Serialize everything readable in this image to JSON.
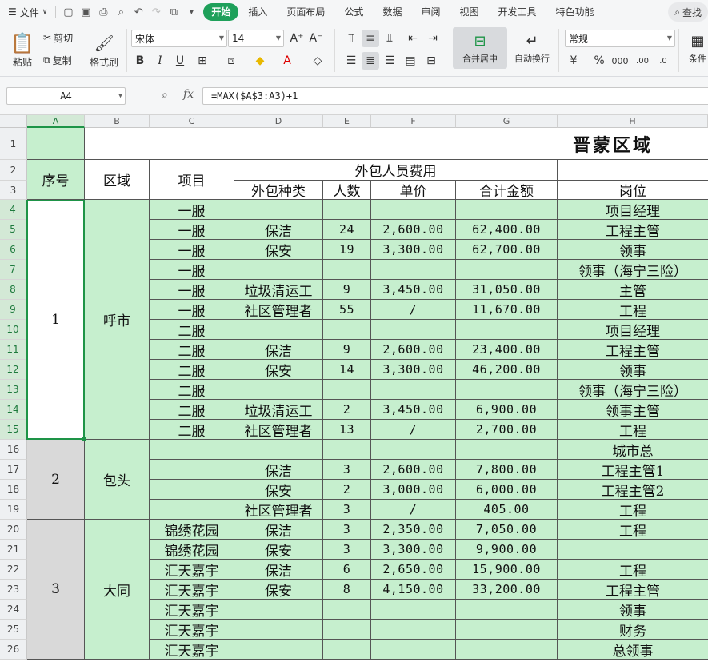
{
  "menu": {
    "file": "文件",
    "tabs": [
      "开始",
      "插入",
      "页面布局",
      "公式",
      "数据",
      "审阅",
      "视图",
      "开发工具",
      "特色功能"
    ],
    "active_tab": "开始",
    "search": "查找",
    "active_color": "#1ea05a"
  },
  "ribbon": {
    "paste": "粘贴",
    "cut": "剪切",
    "copy": "复制",
    "format_painter": "格式刷",
    "font_name": "宋体",
    "font_size": "14",
    "merge_center": "合并居中",
    "wrap_text": "自动换行",
    "number_format": "常规",
    "condition": "条件"
  },
  "formula_bar": {
    "cell_ref": "A4",
    "fx": "fx",
    "formula": "=MAX($A$3:A3)+1"
  },
  "columns": [
    "A",
    "B",
    "C",
    "D",
    "E",
    "F",
    "G",
    "H"
  ],
  "rows": [
    "1",
    "2",
    "3",
    "4",
    "5",
    "6",
    "7",
    "8",
    "9",
    "10",
    "11",
    "12",
    "13",
    "14",
    "15",
    "16",
    "17",
    "18",
    "19",
    "20",
    "21",
    "22",
    "23",
    "24",
    "25",
    "26"
  ],
  "sheet": {
    "title": "晋蒙区域",
    "header": {
      "seq": "序号",
      "region": "区域",
      "project": "项目",
      "outsourcing_cost": "外包人员费用",
      "type": "外包种类",
      "count": "人数",
      "unit_price": "单价",
      "total": "合计金额",
      "post": "岗位"
    },
    "groups": [
      {
        "seq": "1",
        "region": "呼市"
      },
      {
        "seq": "2",
        "region": "包头"
      },
      {
        "seq": "3",
        "region": "大同"
      }
    ],
    "data_rows": [
      {
        "project": "一服",
        "type": "",
        "count": "",
        "price": "",
        "total": "",
        "post": "项目经理"
      },
      {
        "project": "一服",
        "type": "保洁",
        "count": "24",
        "price": "2,600.00",
        "total": "62,400.00",
        "post": "工程主管"
      },
      {
        "project": "一服",
        "type": "保安",
        "count": "19",
        "price": "3,300.00",
        "total": "62,700.00",
        "post": "领事"
      },
      {
        "project": "一服",
        "type": "",
        "count": "",
        "price": "",
        "total": "",
        "post": "领事（海宁三险）"
      },
      {
        "project": "一服",
        "type": "垃圾清运工",
        "count": "9",
        "price": "3,450.00",
        "total": "31,050.00",
        "post": "主管"
      },
      {
        "project": "一服",
        "type": "社区管理者",
        "count": "55",
        "price": "/",
        "total": "11,670.00",
        "post": "工程"
      },
      {
        "project": "二服",
        "type": "",
        "count": "",
        "price": "",
        "total": "",
        "post": "项目经理"
      },
      {
        "project": "二服",
        "type": "保洁",
        "count": "9",
        "price": "2,600.00",
        "total": "23,400.00",
        "post": "工程主管"
      },
      {
        "project": "二服",
        "type": "保安",
        "count": "14",
        "price": "3,300.00",
        "total": "46,200.00",
        "post": "领事"
      },
      {
        "project": "二服",
        "type": "",
        "count": "",
        "price": "",
        "total": "",
        "post": "领事（海宁三险）"
      },
      {
        "project": "二服",
        "type": "垃圾清运工",
        "count": "2",
        "price": "3,450.00",
        "total": "6,900.00",
        "post": "领事主管"
      },
      {
        "project": "二服",
        "type": "社区管理者",
        "count": "13",
        "price": "/",
        "total": "2,700.00",
        "post": "工程"
      },
      {
        "project": "",
        "type": "",
        "count": "",
        "price": "",
        "total": "",
        "post": "城市总"
      },
      {
        "project": "",
        "type": "保洁",
        "count": "3",
        "price": "2,600.00",
        "total": "7,800.00",
        "post": "工程主管1"
      },
      {
        "project": "",
        "type": "保安",
        "count": "2",
        "price": "3,000.00",
        "total": "6,000.00",
        "post": "工程主管2"
      },
      {
        "project": "",
        "type": "社区管理者",
        "count": "3",
        "price": "/",
        "total": "405.00",
        "post": "工程"
      },
      {
        "project": "锦绣花园",
        "type": "保洁",
        "count": "3",
        "price": "2,350.00",
        "total": "7,050.00",
        "post": "工程"
      },
      {
        "project": "锦绣花园",
        "type": "保安",
        "count": "3",
        "price": "3,300.00",
        "total": "9,900.00",
        "post": ""
      },
      {
        "project": "汇天嘉宇",
        "type": "保洁",
        "count": "6",
        "price": "2,650.00",
        "total": "15,900.00",
        "post": "工程"
      },
      {
        "project": "汇天嘉宇",
        "type": "保安",
        "count": "8",
        "price": "4,150.00",
        "total": "33,200.00",
        "post": "工程主管"
      },
      {
        "project": "汇天嘉宇",
        "type": "",
        "count": "",
        "price": "",
        "total": "",
        "post": "领事"
      },
      {
        "project": "汇天嘉宇",
        "type": "",
        "count": "",
        "price": "",
        "total": "",
        "post": "财务"
      },
      {
        "project": "汇天嘉宇",
        "type": "",
        "count": "",
        "price": "",
        "total": "",
        "post": "总领事"
      }
    ],
    "colors": {
      "fill": "#c6efce",
      "selection": "#1e9447",
      "gray": "#d9d9d9"
    }
  }
}
